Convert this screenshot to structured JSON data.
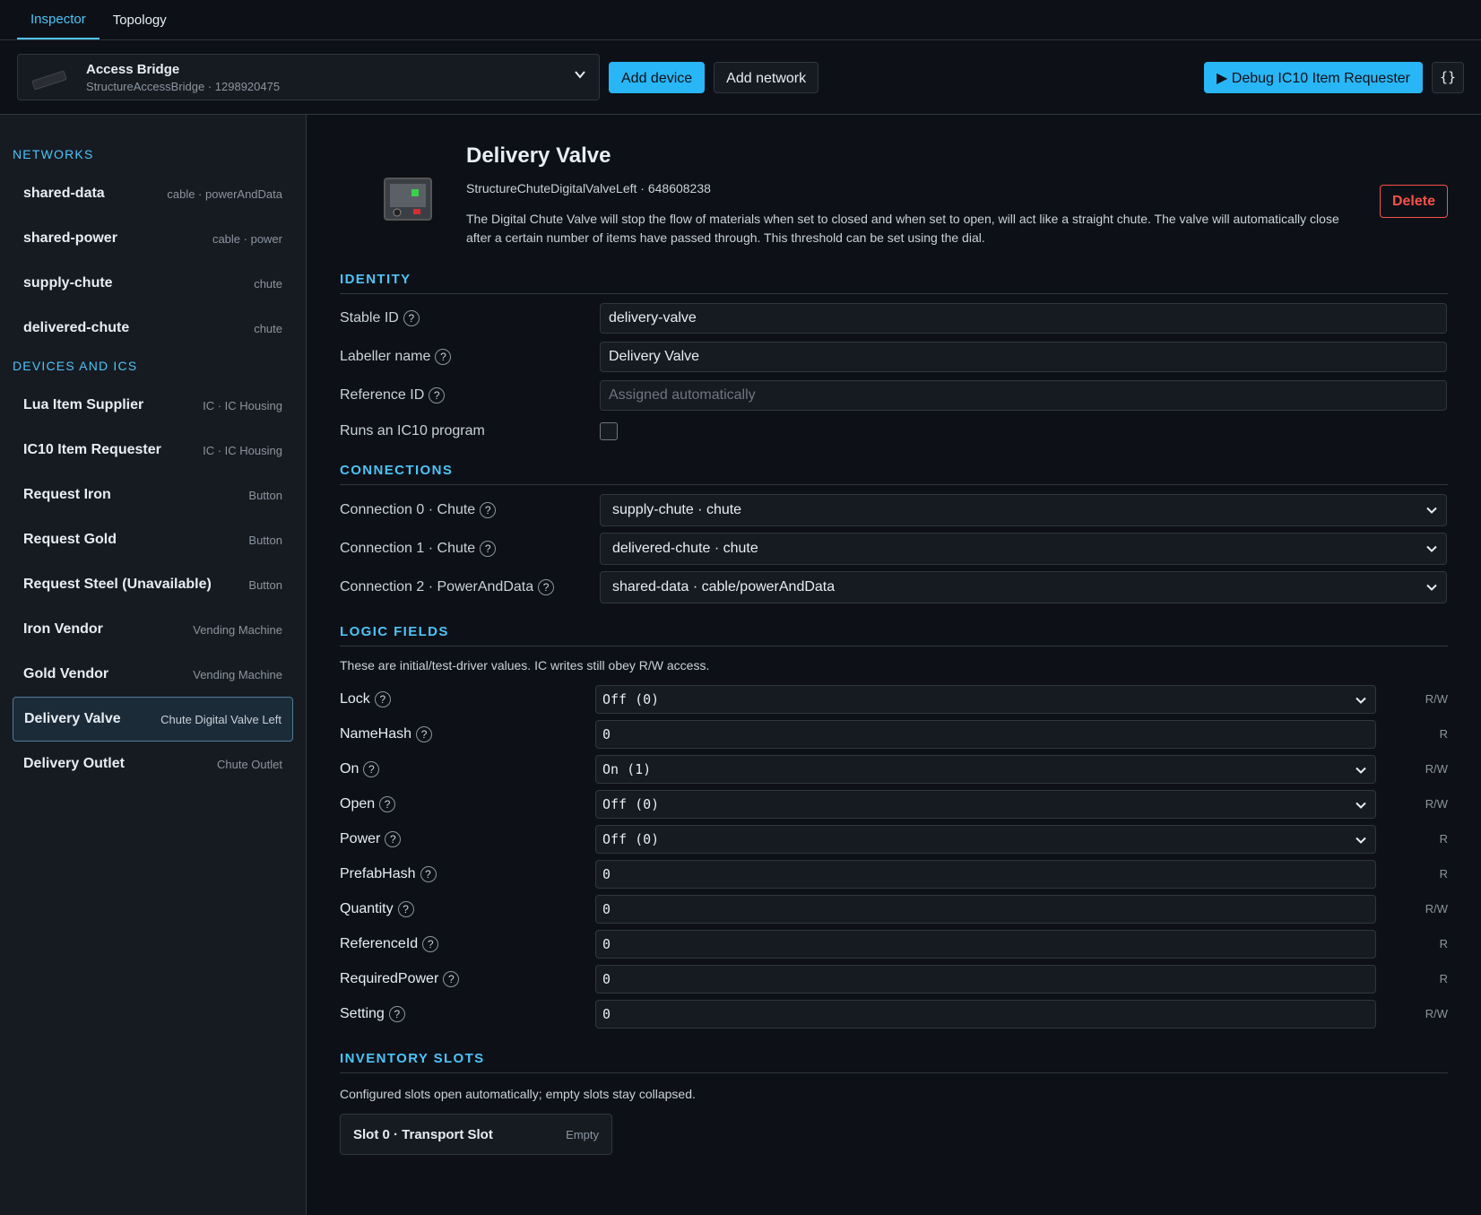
{
  "tabs": [
    {
      "label": "Inspector",
      "active": true
    },
    {
      "label": "Topology",
      "active": false
    }
  ],
  "toolbar": {
    "device_name": "Access Bridge",
    "device_sub": "StructureAccessBridge · 1298920475",
    "add_device": "Add device",
    "add_network": "Add network",
    "debug": "▶ Debug IC10 Item Requester",
    "json_icon": "{}"
  },
  "sidebar": {
    "networks_heading": "NETWORKS",
    "networks": [
      {
        "name": "shared-data",
        "type": "cable · powerAndData"
      },
      {
        "name": "shared-power",
        "type": "cable · power"
      },
      {
        "name": "supply-chute",
        "type": "chute"
      },
      {
        "name": "delivered-chute",
        "type": "chute"
      }
    ],
    "devices_heading": "DEVICES AND ICS",
    "devices": [
      {
        "name": "Lua Item Supplier",
        "type": "IC · IC Housing"
      },
      {
        "name": "IC10 Item Requester",
        "type": "IC · IC Housing"
      },
      {
        "name": "Request Iron",
        "type": "Button"
      },
      {
        "name": "Request Gold",
        "type": "Button"
      },
      {
        "name": "Request Steel (Unavailable)",
        "type": "Button"
      },
      {
        "name": "Iron Vendor",
        "type": "Vending Machine"
      },
      {
        "name": "Gold Vendor",
        "type": "Vending Machine"
      },
      {
        "name": "Delivery Valve",
        "type": "Chute Digital Valve Left",
        "selected": true
      },
      {
        "name": "Delivery Outlet",
        "type": "Chute Outlet"
      }
    ]
  },
  "device": {
    "title": "Delivery Valve",
    "subtitle": "StructureChuteDigitalValveLeft · 648608238",
    "description": "The Digital Chute Valve will stop the flow of materials when set to closed and when set to open, will act like a straight chute. The valve will automatically close after a certain number of items have passed through. This threshold can be set using the dial.",
    "delete_label": "Delete"
  },
  "identity": {
    "heading": "IDENTITY",
    "stable_id_label": "Stable ID",
    "stable_id_value": "delivery-valve",
    "labeller_label": "Labeller name",
    "labeller_value": "Delivery Valve",
    "reference_label": "Reference ID",
    "reference_placeholder": "Assigned automatically",
    "ic10_label": "Runs an IC10 program"
  },
  "connections": {
    "heading": "CONNECTIONS",
    "items": [
      {
        "label": "Connection 0 · Chute",
        "value": "supply-chute · chute"
      },
      {
        "label": "Connection 1 · Chute",
        "value": "delivered-chute · chute"
      },
      {
        "label": "Connection 2 · PowerAndData",
        "value": "shared-data · cable/powerAndData"
      }
    ]
  },
  "logic": {
    "heading": "LOGIC FIELDS",
    "note": "These are initial/test-driver values. IC writes still obey R/W access.",
    "fields": [
      {
        "name": "Lock",
        "value": "Off (0)",
        "access": "R/W",
        "kind": "select"
      },
      {
        "name": "NameHash",
        "value": "0",
        "access": "R",
        "kind": "input"
      },
      {
        "name": "On",
        "value": "On (1)",
        "access": "R/W",
        "kind": "select"
      },
      {
        "name": "Open",
        "value": "Off (0)",
        "access": "R/W",
        "kind": "select"
      },
      {
        "name": "Power",
        "value": "Off (0)",
        "access": "R",
        "kind": "select"
      },
      {
        "name": "PrefabHash",
        "value": "0",
        "access": "R",
        "kind": "input"
      },
      {
        "name": "Quantity",
        "value": "0",
        "access": "R/W",
        "kind": "input"
      },
      {
        "name": "ReferenceId",
        "value": "0",
        "access": "R",
        "kind": "input"
      },
      {
        "name": "RequiredPower",
        "value": "0",
        "access": "R",
        "kind": "input"
      },
      {
        "name": "Setting",
        "value": "0",
        "access": "R/W",
        "kind": "input"
      }
    ]
  },
  "inventory": {
    "heading": "INVENTORY SLOTS",
    "note": "Configured slots open automatically; empty slots stay collapsed.",
    "slots": [
      {
        "name": "Slot 0 · Transport Slot",
        "status": "Empty"
      }
    ]
  }
}
